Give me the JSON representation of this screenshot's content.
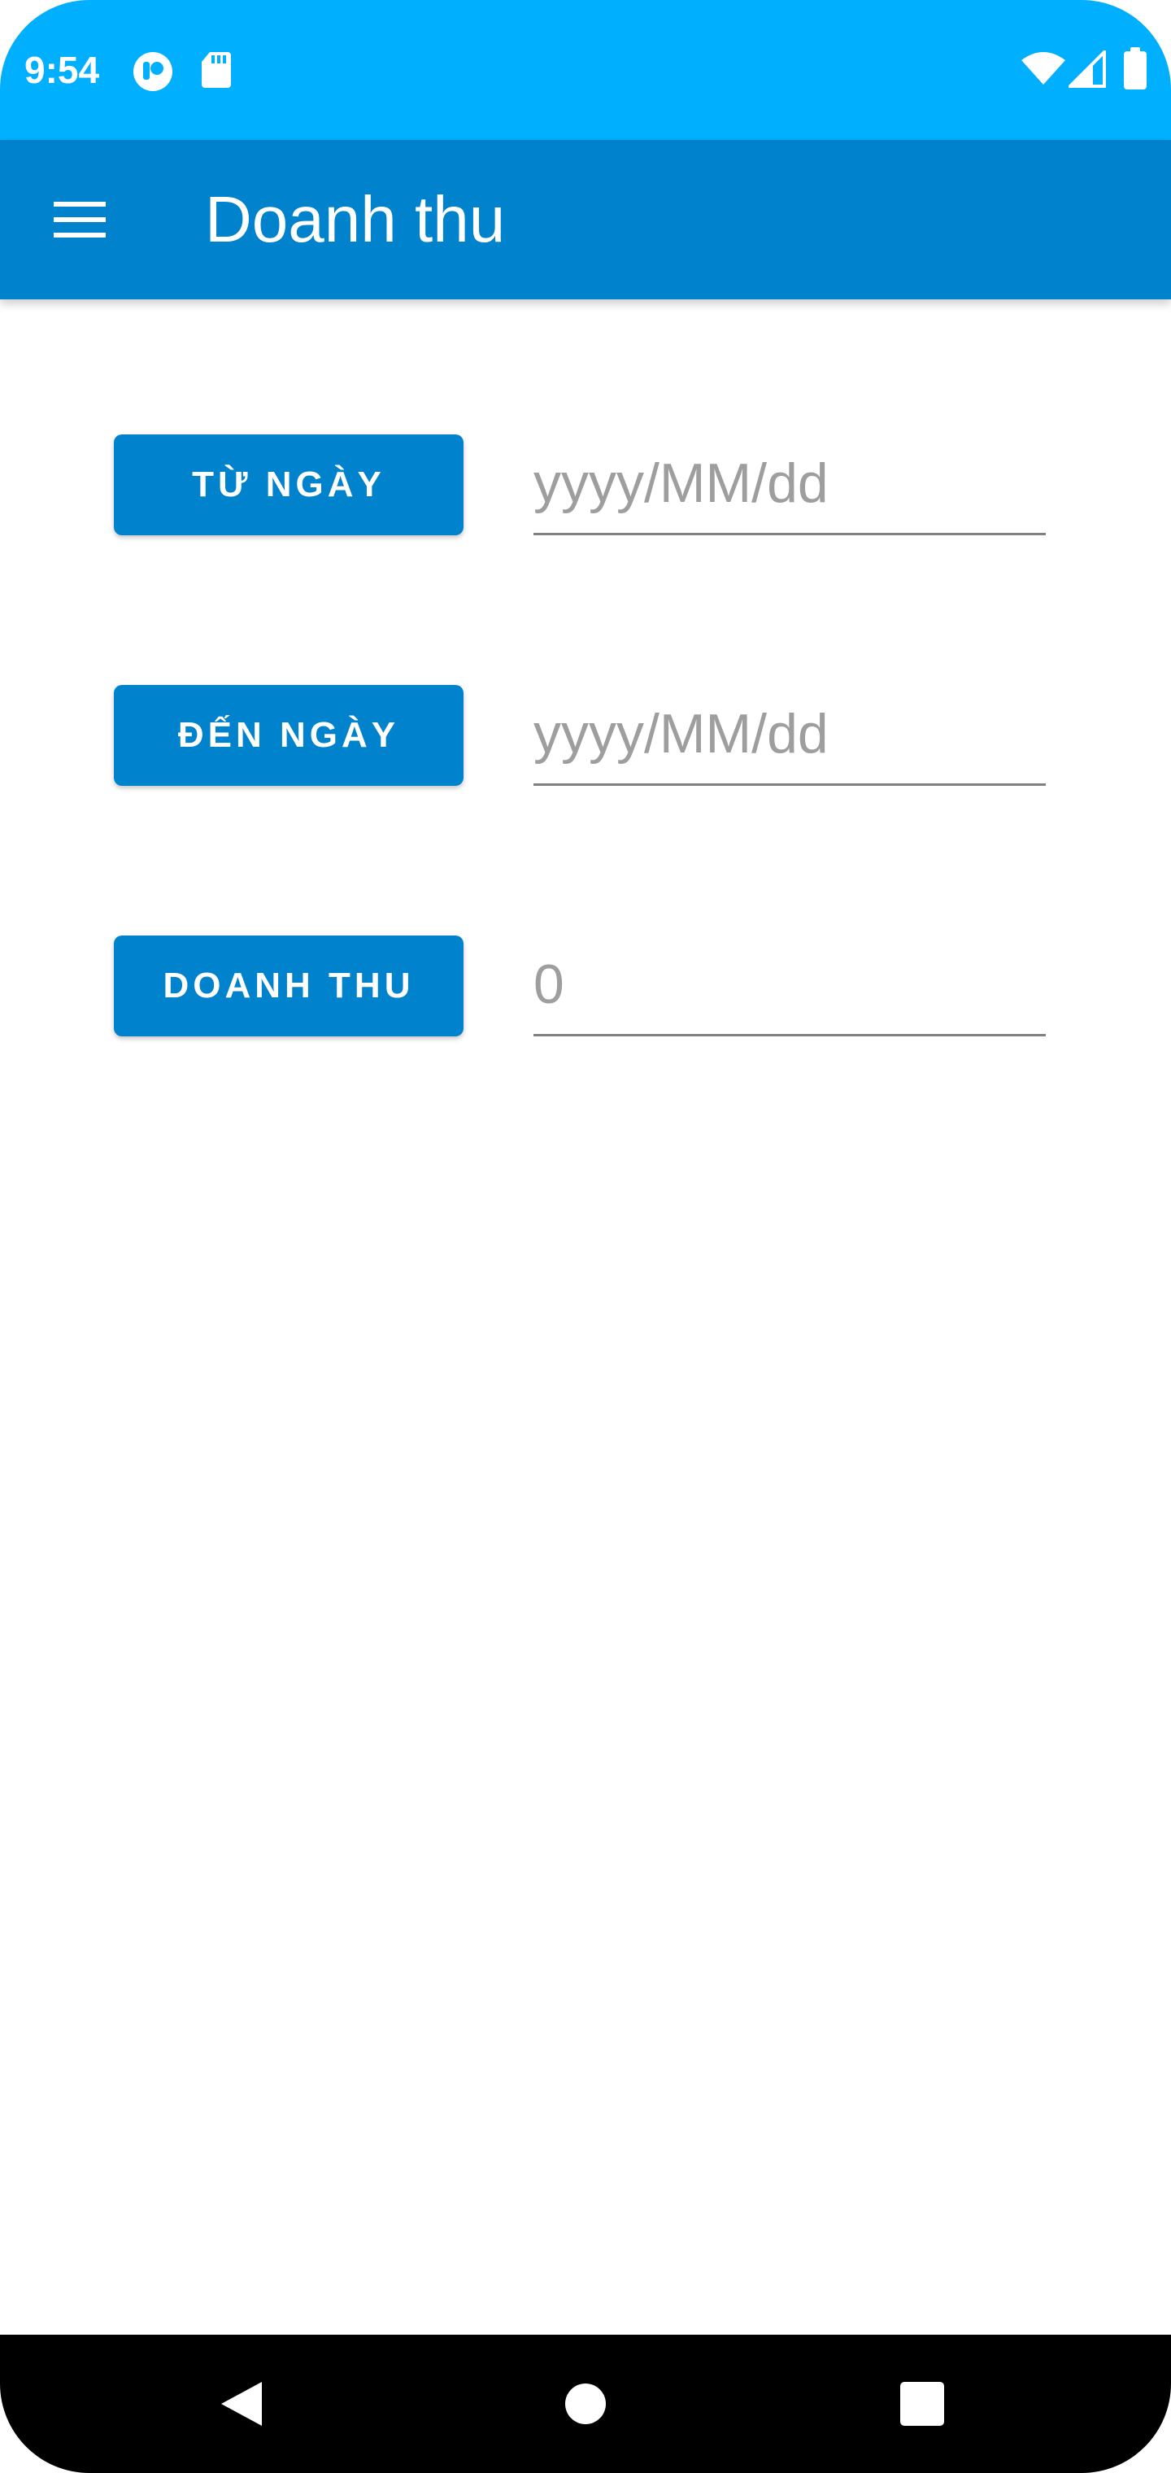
{
  "status_bar": {
    "time": "9:54",
    "left_icons": [
      "notification-app-icon",
      "sd-card-icon"
    ],
    "right_icons": [
      "wifi-icon",
      "cellular-signal-icon",
      "battery-icon"
    ],
    "color": "#00b0ff"
  },
  "app_bar": {
    "title": "Doanh thu",
    "menu_icon": "hamburger-menu-icon",
    "color": "#0082cc"
  },
  "form": {
    "from_date": {
      "button_label": "TỪ NGÀY",
      "placeholder": "yyyy/MM/dd"
    },
    "to_date": {
      "button_label": "ĐẾN NGÀY",
      "placeholder": "yyyy/MM/dd"
    },
    "revenue": {
      "button_label": "DOANH THU",
      "value": "0"
    }
  },
  "nav_bar": {
    "icons": [
      "back-icon",
      "home-icon",
      "recents-icon"
    ]
  }
}
